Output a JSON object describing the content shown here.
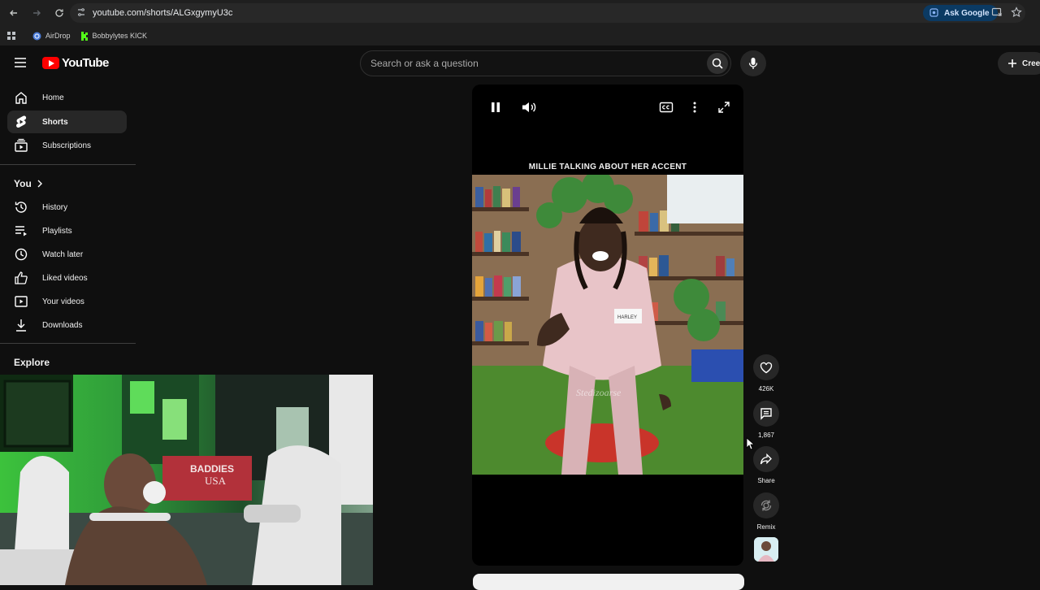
{
  "browser": {
    "url": "youtube.com/shorts/ALGxgymyU3c",
    "ask_google": "Ask Google",
    "bookmarks": [
      {
        "label": "AirDrop",
        "icon": "airdrop-icon"
      },
      {
        "label": "Bobbylytes KICK",
        "icon": "kick-icon",
        "color": "#53fc18"
      }
    ]
  },
  "header": {
    "logo_text": "YouTube",
    "search_placeholder": "Search or ask a question",
    "create_label": "Cree",
    "brand_color": "#ff0000"
  },
  "sidebar": {
    "main_items": [
      {
        "label": "Home",
        "icon": "home-icon"
      },
      {
        "label": "Shorts",
        "icon": "shorts-icon",
        "active": true
      },
      {
        "label": "Subscriptions",
        "icon": "subscriptions-icon"
      }
    ],
    "you_heading": "You",
    "you_items": [
      {
        "label": "History",
        "icon": "history-icon"
      },
      {
        "label": "Playlists",
        "icon": "playlists-icon"
      },
      {
        "label": "Watch later",
        "icon": "watch-later-icon"
      },
      {
        "label": "Liked videos",
        "icon": "liked-videos-icon"
      },
      {
        "label": "Your videos",
        "icon": "your-videos-icon"
      },
      {
        "label": "Downloads",
        "icon": "downloads-icon"
      }
    ],
    "explore_heading": "Explore"
  },
  "short": {
    "title": "MILLIE TALKING ABOUT HER ACCENT",
    "nametag": "HARLEY",
    "watermark": "Stedizoarse"
  },
  "actions": {
    "likes": "426K",
    "comments": "1,867",
    "share": "Share",
    "remix": "Remix"
  },
  "webcam": {
    "sign_line1": "BADDIES",
    "sign_line2": "USA"
  }
}
